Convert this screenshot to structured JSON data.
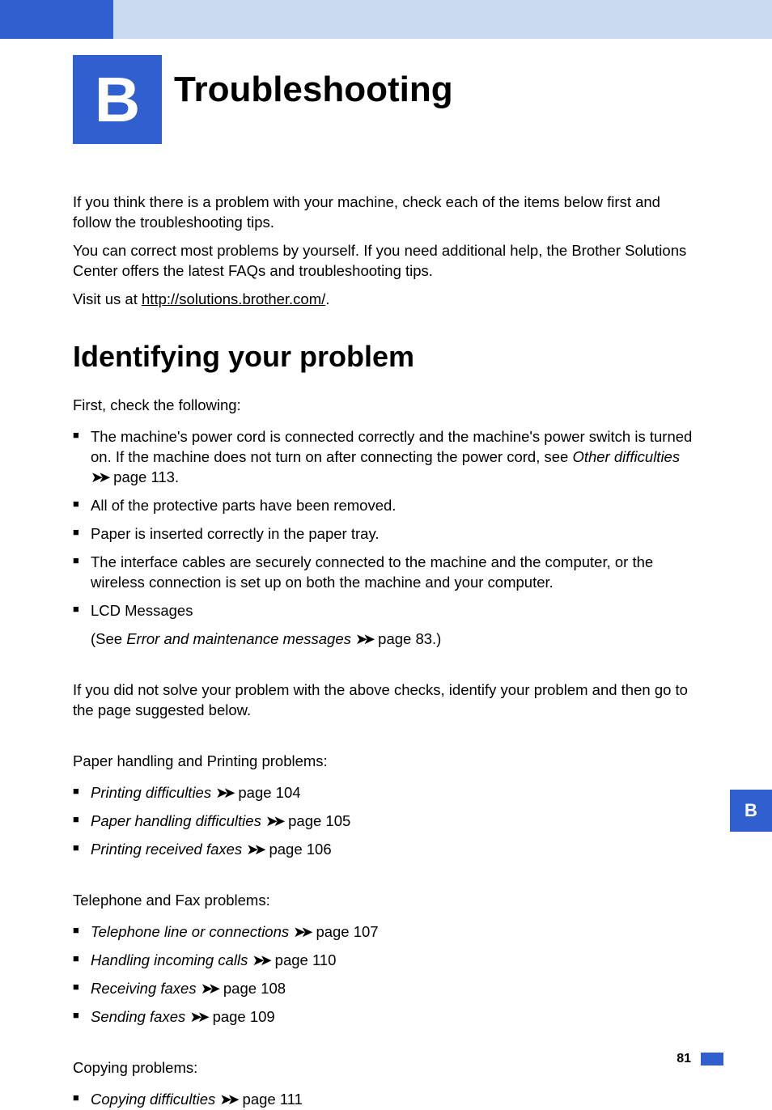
{
  "chapter": {
    "letter": "B",
    "title": "Troubleshooting"
  },
  "intro": {
    "p1": "If you think there is a problem with your machine, check each of the items below first and follow the troubleshooting tips.",
    "p2": "You can correct most problems by yourself. If you need additional help, the Brother Solutions Center offers the latest FAQs and troubleshooting tips.",
    "p3_pre": "Visit us at ",
    "p3_link": "http://solutions.brother.com/",
    "p3_post": "."
  },
  "section1": {
    "heading": "Identifying your problem",
    "lead": "First, check the following:",
    "bullets": [
      {
        "text_pre": "The machine's power cord is connected correctly and the machine's power switch is turned on. If the machine does not turn on after connecting the power cord, see ",
        "italic": "Other difficulties",
        "text_post": " ",
        "page_ref": "page 113."
      },
      {
        "text": "All of the protective parts have been removed."
      },
      {
        "text": "Paper is inserted correctly in the paper tray."
      },
      {
        "text": "The interface cables are securely connected to the machine and the computer, or the wireless connection is set up on both the machine and your computer."
      },
      {
        "text": "LCD Messages"
      }
    ],
    "lcd_sub_pre": "(See ",
    "lcd_sub_italic": "Error and maintenance messages",
    "lcd_sub_post": " page 83.)",
    "para2": "If you did not solve your problem with the above checks, identify your problem and then go to the page suggested below."
  },
  "group_paper": {
    "heading": "Paper handling and Printing problems:",
    "items": [
      {
        "italic": "Printing difficulties",
        "page": "page 104"
      },
      {
        "italic": "Paper handling difficulties",
        "page": "page 105"
      },
      {
        "italic": "Printing received faxes",
        "page": "page 106"
      }
    ]
  },
  "group_phone": {
    "heading": "Telephone and Fax problems:",
    "items": [
      {
        "italic": "Telephone line or connections",
        "page": "page 107"
      },
      {
        "italic": "Handling incoming calls",
        "page": "page 110"
      },
      {
        "italic": "Receiving faxes",
        "page": "page 108"
      },
      {
        "italic": "Sending faxes",
        "page": "page 109"
      }
    ]
  },
  "group_copy": {
    "heading": "Copying problems:",
    "items": [
      {
        "italic": "Copying difficulties",
        "page": "page 111"
      }
    ]
  },
  "side_tab": "B",
  "page_number": "81",
  "arrows": "➤➤"
}
